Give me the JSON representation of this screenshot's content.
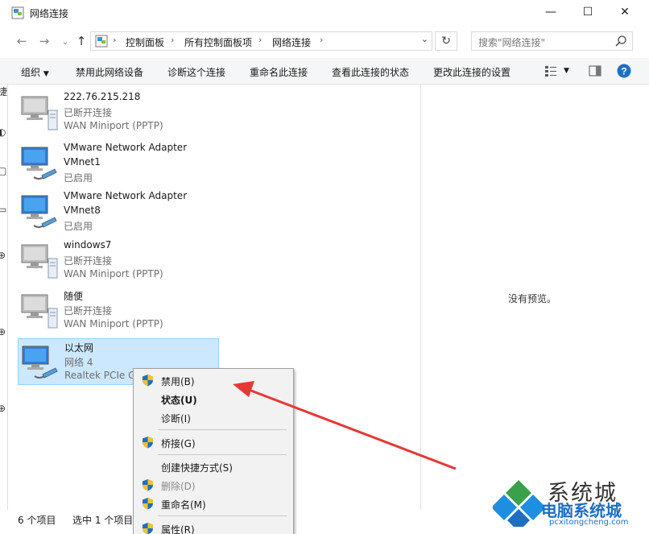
{
  "window": {
    "title": "网络连接",
    "buttons": {
      "minimize": "—",
      "maximize": "☐",
      "close": "✕"
    }
  },
  "nav": {
    "breadcrumb": [
      "控制面板",
      "所有控制面板项",
      "网络连接"
    ],
    "search_placeholder": "搜索\"网络连接\""
  },
  "toolbar": {
    "organize": "组织",
    "disable_device": "禁用此网络设备",
    "diagnose": "诊断这个连接",
    "rename": "重命名此连接",
    "view_status": "查看此连接的状态",
    "change_settings": "更改此连接的设置"
  },
  "connections": [
    {
      "name": "222.76.215.218",
      "status": "已断开连接",
      "device": "WAN Miniport (PPTP)",
      "kind": "wan"
    },
    {
      "name": "VMware Network Adapter",
      "status": "VMnet1",
      "device": "已启用",
      "kind": "lan"
    },
    {
      "name": "VMware Network Adapter",
      "status": "VMnet8",
      "device": "已启用",
      "kind": "lan"
    },
    {
      "name": "windows7",
      "status": "已断开连接",
      "device": "WAN Miniport (PPTP)",
      "kind": "wan"
    },
    {
      "name": "随便",
      "status": "已断开连接",
      "device": "WAN Miniport (PPTP)",
      "kind": "wan"
    },
    {
      "name": "以太网",
      "status": "网络 4",
      "device": "Realtek PCIe G",
      "kind": "lan",
      "selected": true
    }
  ],
  "preview": {
    "empty_text": "没有预览。"
  },
  "statusbar": {
    "count": "6 个项目",
    "selected": "选中 1 个项目"
  },
  "context_menu": {
    "disable": "禁用(B)",
    "status": "状态(U)",
    "diagnose": "诊断(I)",
    "bridge": "桥接(G)",
    "create_shortcut": "创建快捷方式(S)",
    "delete": "删除(D)",
    "rename": "重命名(M)",
    "properties": "属性(R)"
  },
  "watermark": {
    "brand": "系统城",
    "sub": "电脑系统城",
    "url": "pcxitongcheng.com"
  },
  "colors": {
    "selection": "#cce8ff",
    "arrow": "#e53935",
    "help": "#1e6fc2"
  }
}
